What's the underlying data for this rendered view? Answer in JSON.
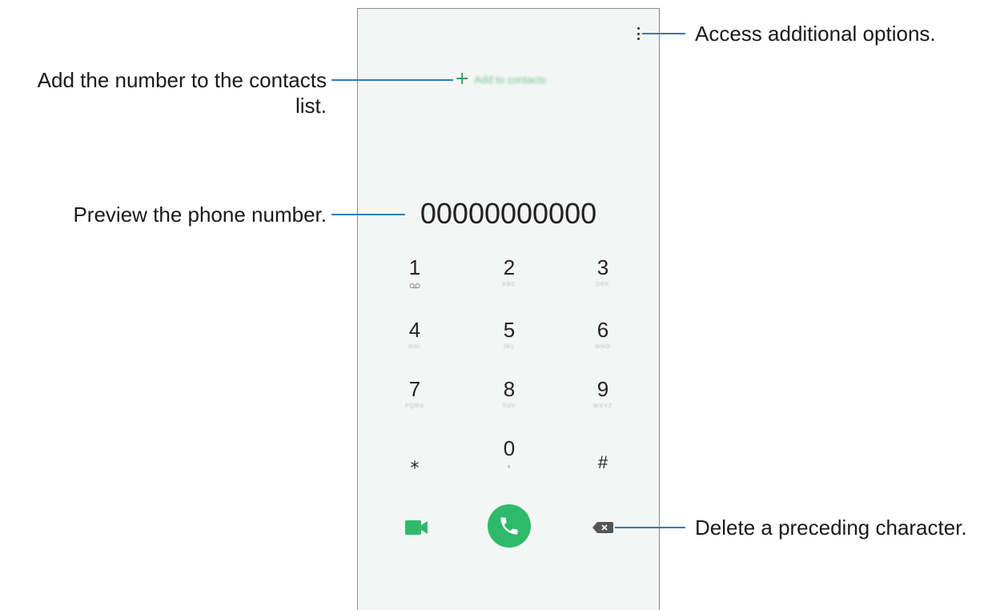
{
  "callouts": {
    "options": "Access additional options.",
    "add_contacts": "Add the number to the contacts list.",
    "preview": "Preview the phone number.",
    "delete": "Delete a preceding character."
  },
  "dialer": {
    "add_to_contacts_label": "Add to contacts",
    "number": "00000000000",
    "keys": [
      {
        "digit": "1",
        "letters": ""
      },
      {
        "digit": "2",
        "letters": "ABC"
      },
      {
        "digit": "3",
        "letters": "DEF"
      },
      {
        "digit": "4",
        "letters": "GHI"
      },
      {
        "digit": "5",
        "letters": "JKL"
      },
      {
        "digit": "6",
        "letters": "MNO"
      },
      {
        "digit": "7",
        "letters": "PQRS"
      },
      {
        "digit": "8",
        "letters": "TUV"
      },
      {
        "digit": "9",
        "letters": "WXYZ"
      },
      {
        "digit": "⁎",
        "letters": ""
      },
      {
        "digit": "0",
        "letters": "+"
      },
      {
        "digit": "#",
        "letters": ""
      }
    ]
  },
  "colors": {
    "accent": "#2fba6b",
    "callout_line": "#2a7fb8",
    "screen_bg": "#f3f6f4"
  },
  "icons": {
    "menu": "more-options-icon",
    "add": "plus-icon",
    "voicemail": "voicemail-icon",
    "video": "video-call-icon",
    "call": "phone-icon",
    "backspace": "backspace-icon"
  }
}
